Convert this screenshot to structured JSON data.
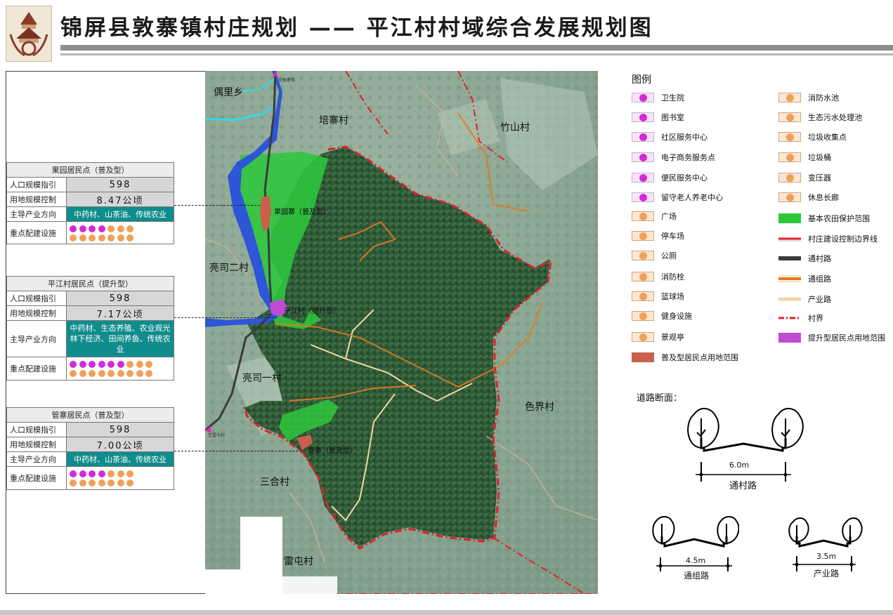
{
  "header": {
    "title": "锦屏县敦寨镇村庄规划 —— 平江村村域综合发展规划图"
  },
  "colors": {
    "farmland": "#2ec73c",
    "village_boundary": "#e2202a",
    "river": "#2d56d8",
    "upgrade_site": "#c14ad4",
    "general_site": "#c8604a",
    "group_road": "#e87820",
    "table_band": "#0f8c8c"
  },
  "settlements": [
    {
      "name": "果园居民点（普及型）",
      "pop_label": "人口规模指引",
      "pop": "598",
      "land_label": "用地规模控制",
      "land": "8.47公顷",
      "ind_label": "主导产业方向",
      "industry": "中药材、山茶油、传统农业",
      "fac_label": "重点配建设施"
    },
    {
      "name": "平江村居民点（提升型）",
      "pop_label": "人口规模指引",
      "pop": "598",
      "land_label": "用地规模控制",
      "land": "7.17公顷",
      "ind_label": "主导产业方向",
      "industry": "中药材、生态养殖、农业观光林下经济、田间养鱼、传统农业",
      "fac_label": "重点配建设施"
    },
    {
      "name": "管寨居民点（普及型）",
      "pop_label": "人口规模指引",
      "pop": "598",
      "land_label": "用地规模控制",
      "land": "7.00公顷",
      "ind_label": "主导产业方向",
      "industry": "中药材、山茶油、传统农业",
      "fac_label": "重点配建设施"
    }
  ],
  "map_labels": {
    "ouli": "偶里乡",
    "peizhai": "培寨村",
    "zhushan": "竹山村",
    "liangsi2": "亮司二村",
    "liangsi1": "亮司一村",
    "sejie": "色界村",
    "sanhe": "三合村",
    "leitun": "雷屯村",
    "guoyuan": "果园寨（普及型）",
    "pingjiang": "平江村（提升型）",
    "guanzhai": "管寨（普及型）",
    "tiny1": "至敦寨镇",
    "tiny2": "至雷屯村"
  },
  "legend": {
    "title": "图例",
    "left": [
      {
        "icon": "health-center-icon",
        "label": "卫生院"
      },
      {
        "icon": "library-icon",
        "label": "图书室"
      },
      {
        "icon": "community-center-icon",
        "label": "社区服务中心"
      },
      {
        "icon": "ecommerce-icon",
        "label": "电子商务服务点"
      },
      {
        "icon": "convenience-center-icon",
        "label": "便民服务中心"
      },
      {
        "icon": "elderly-center-icon",
        "label": "留守老人养老中心"
      },
      {
        "icon": "square-icon",
        "label": "广场"
      },
      {
        "icon": "parking-icon",
        "label": "停车场"
      },
      {
        "icon": "toilet-icon",
        "label": "公厕"
      },
      {
        "icon": "hydrant-icon",
        "label": "消防栓"
      },
      {
        "icon": "basketball-icon",
        "label": "篮球场"
      },
      {
        "icon": "fitness-icon",
        "label": "健身设施"
      },
      {
        "icon": "pavilion-icon",
        "label": "景观亭"
      },
      {
        "icon": "general-site-swatch",
        "label": "普及型居民点用地范围"
      }
    ],
    "right": [
      {
        "icon": "fire-pool-icon",
        "label": "消防水池"
      },
      {
        "icon": "sewage-plant-icon",
        "label": "生态污水处理池"
      },
      {
        "icon": "garbage-station-icon",
        "label": "垃圾收集点"
      },
      {
        "icon": "garbage-bin-icon",
        "label": "垃圾桶"
      },
      {
        "icon": "transformer-icon",
        "label": "变压器"
      },
      {
        "icon": "corridor-icon",
        "label": "休息长廊"
      },
      {
        "icon": "farmland-swatch",
        "label": "基本农田保护范围"
      },
      {
        "icon": "boundary-line",
        "label": "村庄建设控制边界线"
      },
      {
        "icon": "village-road-line",
        "label": "通村路"
      },
      {
        "icon": "group-road-line",
        "label": "通组路"
      },
      {
        "icon": "industry-road-line",
        "label": "产业路"
      },
      {
        "icon": "village-border-line",
        "label": "村界"
      },
      {
        "icon": "upgrade-site-swatch",
        "label": "提升型居民点用地范围"
      }
    ]
  },
  "road_sections": {
    "title": "道路断面：",
    "village": {
      "width": "6.0m",
      "name": "通村路"
    },
    "group": {
      "width": "4.5m",
      "name": "通组路"
    },
    "industry": {
      "width": "3.5m",
      "name": "产业路"
    }
  }
}
